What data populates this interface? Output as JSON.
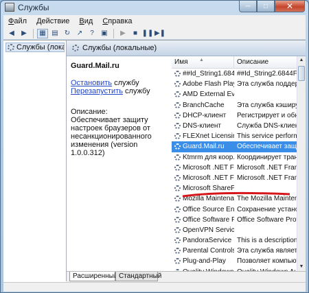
{
  "window": {
    "title": "Службы"
  },
  "menu": [
    {
      "label": "Файл",
      "accel": "Ф"
    },
    {
      "label": "Действие",
      "accel": "Д"
    },
    {
      "label": "Вид",
      "accel": "В"
    },
    {
      "label": "Справка",
      "accel": "С"
    }
  ],
  "tree": {
    "item": "Службы (локалы"
  },
  "pane": {
    "header": "Службы (локальные)"
  },
  "details": {
    "service_name": "Guard.Mail.ru",
    "stop_link": "Остановить",
    "stop_suffix": " службу",
    "restart_link": "Перезапустить",
    "restart_suffix": " службу",
    "description_label": "Описание:",
    "description_text": "Обеспечивает защиту настроек браузеров от несанкционированного изменения (version 1.0.0.312)"
  },
  "list": {
    "columns": {
      "name": "Имя",
      "description": "Описание"
    },
    "rows": [
      {
        "name": "##Id_String1.6844...",
        "description": "##Id_String2.6844F930_1"
      },
      {
        "name": "Adobe Flash Play...",
        "description": "Эта служба поддержив"
      },
      {
        "name": "AMD External Eve...",
        "description": ""
      },
      {
        "name": "BranchCache",
        "description": "Эта служба кэширует с"
      },
      {
        "name": "DHCP-клиент",
        "description": "Регистрирует и обнова"
      },
      {
        "name": "DNS-клиент",
        "description": "Служба DNS-клиента ("
      },
      {
        "name": "FLEXnet Licensing...",
        "description": "This service performs lic"
      },
      {
        "name": "Guard.Mail.ru",
        "description": "Обеспечивает защиту",
        "selected": true
      },
      {
        "name": "Ktmrm для коор...",
        "description": "Координирует транзак"
      },
      {
        "name": "Microsoft .NET Fr...",
        "description": "Microsoft .NET Framew"
      },
      {
        "name": "Microsoft .NET Fr...",
        "description": "Microsoft .NET Framew"
      },
      {
        "name": "Microsoft SharePo...",
        "description": ""
      },
      {
        "name": "Mozilla Maintena...",
        "description": "The Mozilla Maintenanc"
      },
      {
        "name": "Office  Source En...",
        "description": "Сохранение установоч"
      },
      {
        "name": "Office Software Pr...",
        "description": "Office Software Protectio"
      },
      {
        "name": "OpenVPN Service",
        "description": ""
      },
      {
        "name": "PandoraService",
        "description": "This is a description for"
      },
      {
        "name": "Parental Controls",
        "description": "Эта служба является за"
      },
      {
        "name": "Plug-and-Play",
        "description": "Позволяет компьютер"
      },
      {
        "name": "Quality Windows ...",
        "description": "Quality Windows Audio"
      }
    ]
  },
  "tabs": [
    {
      "label": "Расширенный",
      "active": true
    },
    {
      "label": "Стандартный",
      "active": false
    }
  ]
}
